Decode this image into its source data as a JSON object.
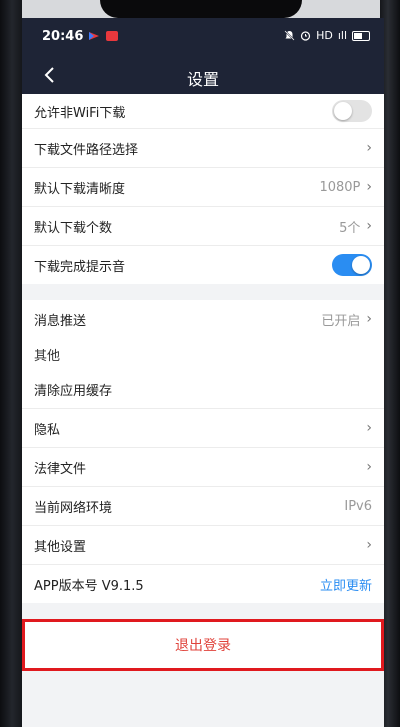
{
  "status": {
    "time": "20:46",
    "indicators": "HD",
    "signal": "ıll"
  },
  "nav": {
    "title": "设置",
    "back_icon": "chevron-left-icon"
  },
  "download": {
    "allow_non_wifi": {
      "label": "允许非WiFi下载",
      "on": false
    },
    "path": {
      "label": "下载文件路径选择"
    },
    "quality": {
      "label": "默认下载清晰度",
      "value": "1080P"
    },
    "count": {
      "label": "默认下载个数",
      "value": "5个"
    },
    "sound": {
      "label": "下载完成提示音",
      "on": true
    }
  },
  "push": {
    "label": "消息推送",
    "value": "已开启"
  },
  "other": {
    "header": "其他",
    "clear_cache": "清除应用缓存",
    "privacy": "隐私",
    "legal": "法律文件",
    "network": {
      "label": "当前网络环境",
      "value": "IPv6"
    },
    "more": "其他设置",
    "version": {
      "label": "APP版本号 V9.1.5",
      "action": "立即更新"
    }
  },
  "logout": {
    "label": "退出登录"
  },
  "colors": {
    "header_bg": "#1e2436",
    "accent": "#2a8df2",
    "logout_text": "#e0433b",
    "highlight_border": "#e0191e"
  }
}
